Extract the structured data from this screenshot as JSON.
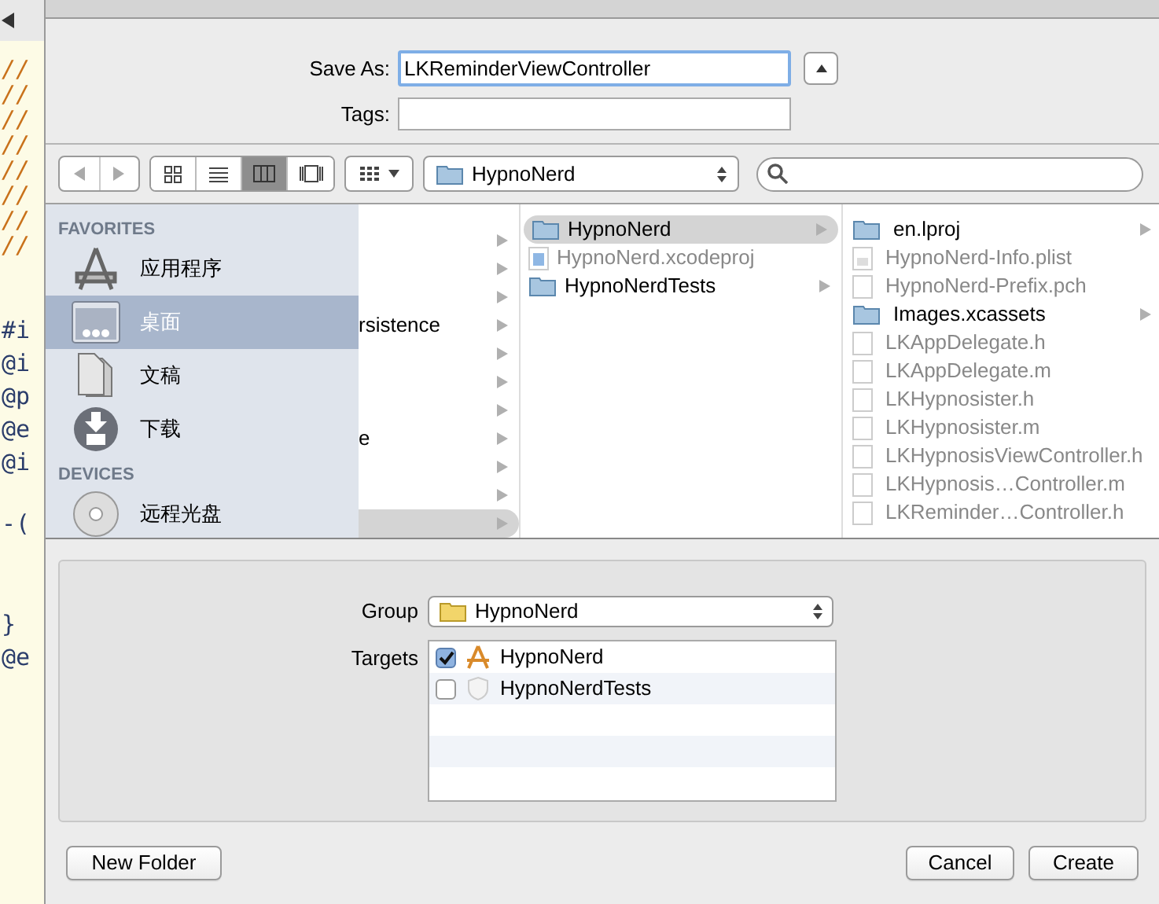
{
  "code_editor": {
    "blocks": [
      [
        "//",
        "//",
        "//",
        "//",
        "//",
        "//",
        "//",
        "//"
      ],
      [
        "#i",
        "@i",
        "@p",
        "@e",
        "@i"
      ],
      [
        "-("
      ],
      [
        "}",
        "@e"
      ]
    ]
  },
  "save_as": {
    "label": "Save As:",
    "value": "LKReminderViewController"
  },
  "tags": {
    "label": "Tags:"
  },
  "toolbar": {
    "views": [
      {
        "kind": "icons",
        "selected": false
      },
      {
        "kind": "list",
        "selected": false
      },
      {
        "kind": "columns",
        "selected": true
      },
      {
        "kind": "coverflow",
        "selected": false
      }
    ],
    "location": "HypnoNerd"
  },
  "sidebar": {
    "sections": [
      {
        "title": "FAVORITES",
        "items": [
          {
            "label": "应用程序",
            "kind": "apps",
            "selected": false
          },
          {
            "label": "桌面",
            "kind": "desktop",
            "selected": true
          },
          {
            "label": "文稿",
            "kind": "documents",
            "selected": false
          },
          {
            "label": "下载",
            "kind": "downloads",
            "selected": false
          }
        ]
      },
      {
        "title": "DEVICES",
        "items": [
          {
            "label": "远程光盘",
            "kind": "disc",
            "selected": false
          }
        ]
      }
    ]
  },
  "column_1": [
    {
      "selected": false
    },
    {
      "selected": false
    },
    {
      "selected": false
    },
    {
      "label": "rsistence",
      "selected": false
    },
    {
      "selected": false
    },
    {
      "selected": false
    },
    {
      "selected": false
    },
    {
      "label": "e",
      "selected": false
    },
    {
      "selected": false
    },
    {
      "selected": false
    },
    {
      "selected": true
    }
  ],
  "column_2": [
    {
      "label": "HypnoNerd",
      "kind": "folder",
      "selected": true,
      "disabled": false
    },
    {
      "label": "HypnoNerd.xcodeproj",
      "kind": "project",
      "selected": false,
      "disabled": true
    },
    {
      "label": "HypnoNerdTests",
      "kind": "folder",
      "selected": false,
      "disabled": false
    }
  ],
  "column_3": [
    {
      "label": "en.lproj",
      "kind": "folder",
      "disabled": false
    },
    {
      "label": "HypnoNerd-Info.plist",
      "kind": "plist",
      "disabled": true
    },
    {
      "label": "HypnoNerd-Prefix.pch",
      "kind": "h",
      "disabled": true
    },
    {
      "label": "Images.xcassets",
      "kind": "folder",
      "disabled": false
    },
    {
      "label": "LKAppDelegate.h",
      "kind": "h",
      "disabled": true
    },
    {
      "label": "LKAppDelegate.m",
      "kind": "m",
      "disabled": true
    },
    {
      "label": "LKHypnosister.h",
      "kind": "h",
      "disabled": true
    },
    {
      "label": "LKHypnosister.m",
      "kind": "m",
      "disabled": true
    },
    {
      "label": "LKHypnosisViewController.h",
      "kind": "h",
      "disabled": true
    },
    {
      "label": "LKHypnosis…Controller.m",
      "kind": "m",
      "disabled": true
    },
    {
      "label": "LKReminder…Controller.h",
      "kind": "h",
      "disabled": true
    }
  ],
  "group": {
    "label": "Group",
    "value": "HypnoNerd"
  },
  "targets": {
    "label": "Targets",
    "items": [
      {
        "label": "HypnoNerd",
        "kind": "app",
        "checked": true
      },
      {
        "label": "HypnoNerdTests",
        "kind": "tests",
        "checked": false
      }
    ]
  },
  "buttons": {
    "new_folder": "New Folder",
    "cancel": "Cancel",
    "create": "Create"
  }
}
